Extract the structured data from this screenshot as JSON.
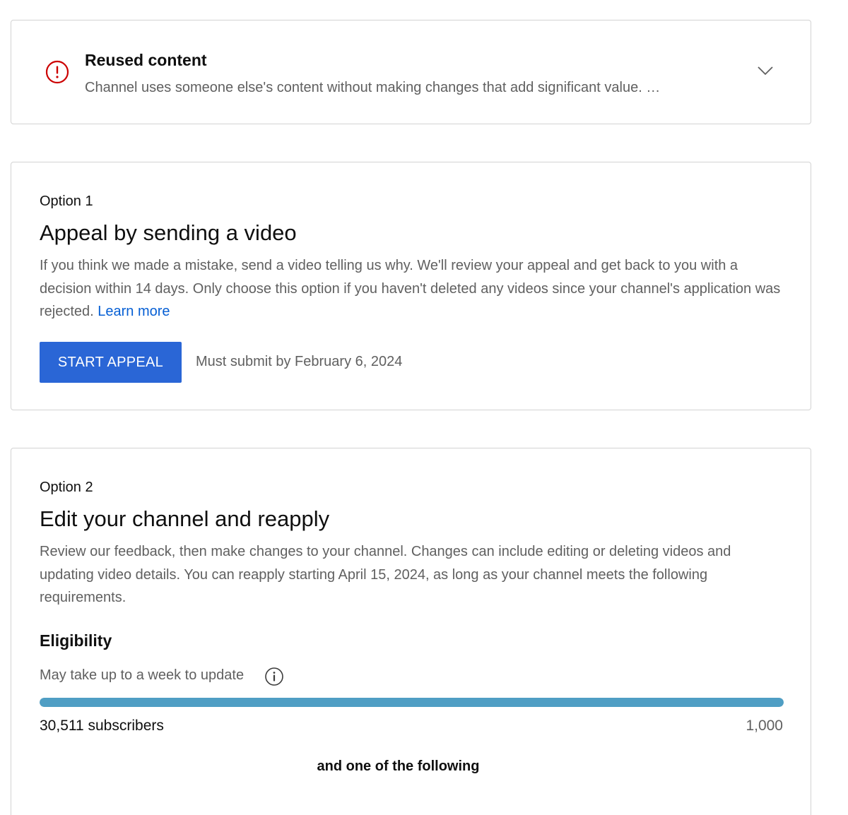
{
  "reused": {
    "title": "Reused content",
    "description": "Channel uses someone else's content without making changes that add significant value. …",
    "icon": "alert-circle-icon",
    "icon_color": "#cc0000"
  },
  "option1": {
    "label": "Option 1",
    "title": "Appeal by sending a video",
    "description": "If you think we made a mistake, send a video telling us why. We'll review your appeal and get back to you with a decision within 14 days. Only choose this option if you haven't deleted any videos since your channel's application was rejected.",
    "learn_more": "Learn more",
    "button_label": "START APPEAL",
    "button_color": "#2a66d6",
    "deadline": "Must submit by February 6, 2024"
  },
  "option2": {
    "label": "Option 2",
    "title": "Edit your channel and reapply",
    "description": "Review our feedback, then make changes to your channel. Changes can include editing or deleting videos and updating video details. You can reapply starting April 15, 2024, as long as your channel meets the following requirements.",
    "eligibility": {
      "heading": "Eligibility",
      "note": "May take up to a week to update",
      "progress_fraction": 1.0,
      "progress_color": "#4f9ec4",
      "subscribers": "30,511 subscribers",
      "goal": "1,000"
    },
    "and_one": "and one of the following"
  }
}
